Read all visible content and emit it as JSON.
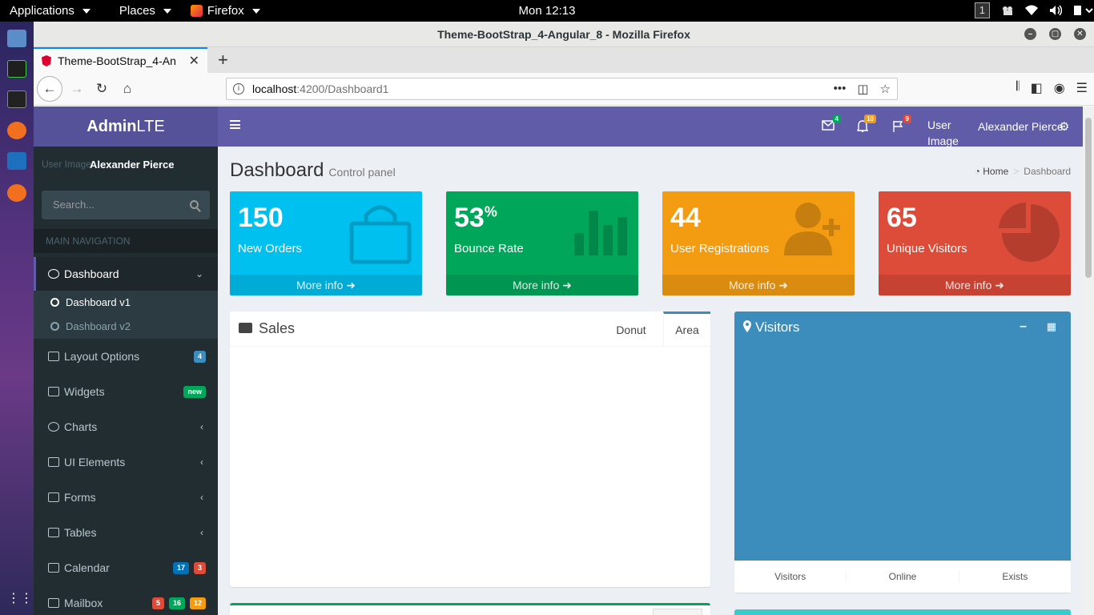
{
  "gnome": {
    "applications": "Applications",
    "places": "Places",
    "firefox": "Firefox",
    "clock": "Mon 12:13",
    "workspace": "1"
  },
  "window": {
    "title": "Theme-BootStrap_4-Angular_8 - Mozilla Firefox",
    "tab_title": "Theme-BootStrap_4-An",
    "url_host": "localhost",
    "url_path": ":4200/Dashboard1"
  },
  "header": {
    "logo_bold": "Admin",
    "logo_rest": "LTE",
    "mail_count": "4",
    "notif_count": "10",
    "flag_count": "9",
    "user_image_alt": "User Image",
    "user_name": "Alexander Pierce",
    "colors": {
      "logo_bg": "#555299",
      "nav_bg": "#605ca8"
    }
  },
  "sidebar": {
    "user_image_alt": "User Image",
    "user_name": "Alexander Pierce",
    "search_placeholder": "Search...",
    "nav_header": "MAIN NAVIGATION",
    "items": [
      {
        "label": "Dashboard",
        "icon": "dashboard-icon"
      },
      {
        "label": "Layout Options",
        "icon": "files-icon",
        "badges": [
          "4"
        ]
      },
      {
        "label": "Widgets",
        "icon": "th-icon",
        "badges": [
          "new"
        ]
      },
      {
        "label": "Charts",
        "icon": "pie-chart-icon"
      },
      {
        "label": "UI Elements",
        "icon": "laptop-icon"
      },
      {
        "label": "Forms",
        "icon": "edit-icon"
      },
      {
        "label": "Tables",
        "icon": "table-icon"
      },
      {
        "label": "Calendar",
        "icon": "calendar-icon",
        "badges": [
          "17",
          "3"
        ]
      },
      {
        "label": "Mailbox",
        "icon": "envelope-icon",
        "badges": [
          "5",
          "16",
          "12"
        ]
      }
    ],
    "sub_items": [
      "Dashboard v1",
      "Dashboard v2"
    ]
  },
  "content": {
    "title": "Dashboard",
    "subtitle": "Control panel",
    "breadcrumb_home": "Home",
    "breadcrumb_current": "Dashboard"
  },
  "stats": [
    {
      "value": "150",
      "suffix": "",
      "label": "New Orders",
      "more": "More info",
      "color": "#00c0ef"
    },
    {
      "value": "53",
      "suffix": "%",
      "label": "Bounce Rate",
      "more": "More info",
      "color": "#00a65a"
    },
    {
      "value": "44",
      "suffix": "",
      "label": "User Registrations",
      "more": "More info",
      "color": "#f39c12"
    },
    {
      "value": "65",
      "suffix": "",
      "label": "Unique Visitors",
      "more": "More info",
      "color": "#dd4b39"
    }
  ],
  "sales": {
    "title": "Sales",
    "tab_donut": "Donut",
    "tab_area": "Area"
  },
  "visitors": {
    "title": "Visitors",
    "foot": [
      "Visitors",
      "Online",
      "Exists"
    ]
  }
}
